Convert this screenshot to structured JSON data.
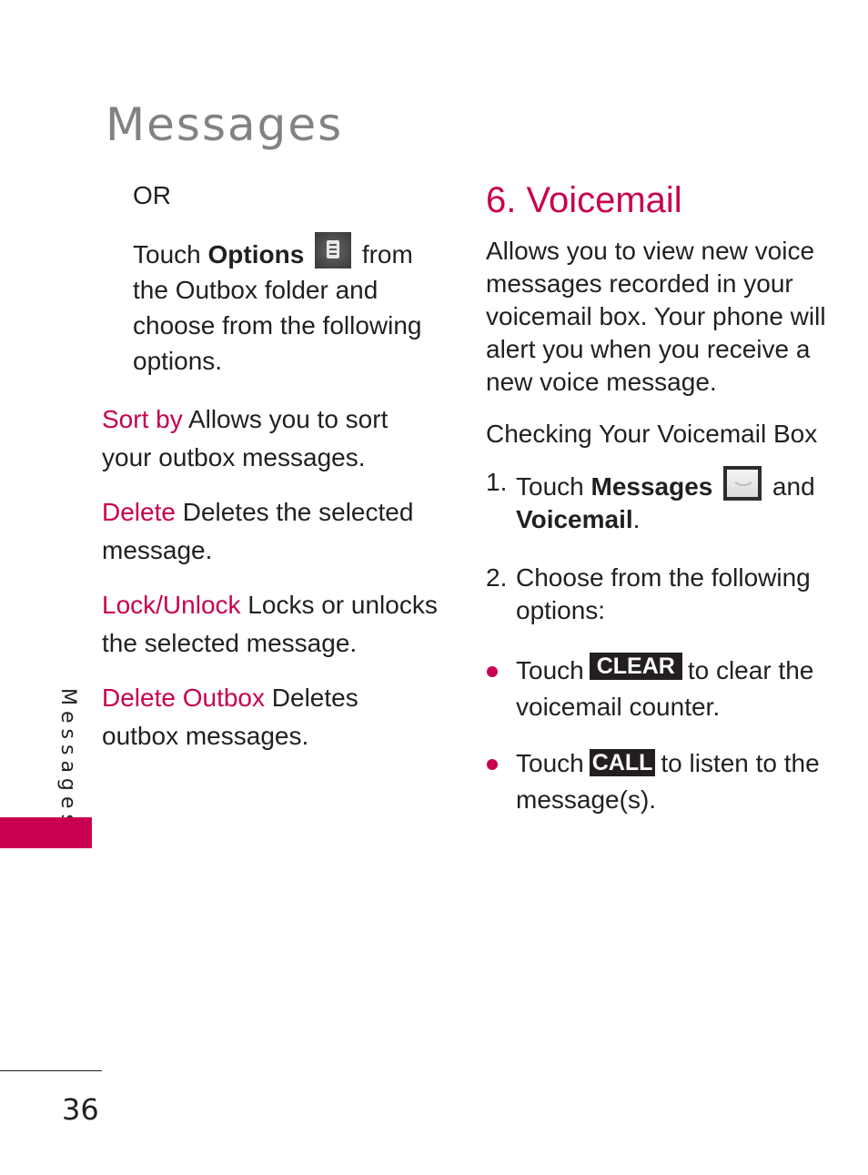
{
  "page": {
    "title": "Messages",
    "side_tab_label": "Messages",
    "page_number": "36",
    "accent_color": "#c8004f"
  },
  "left_column": {
    "or_text": "OR",
    "touch_options": {
      "prefix": "Touch ",
      "bold": "Options",
      "icon": "options-menu-icon",
      "suffix": " from the Outbox folder and choose from the following options."
    },
    "options": [
      {
        "term": "Sort by",
        "description": " Allows you to sort your outbox messages."
      },
      {
        "term": "Delete",
        "description": " Deletes the selected message."
      },
      {
        "term": "Lock/Unlock",
        "description": " Locks or unlocks the selected message."
      },
      {
        "term": "Delete Outbox",
        "description": " Deletes outbox messages."
      }
    ]
  },
  "right_column": {
    "section_title": "6. Voicemail",
    "intro": "Allows you to view new voice messages recorded in your voicemail box. Your phone will alert you when you receive a new voice message.",
    "subheading": "Checking Your Voicemail Box",
    "steps": [
      {
        "number": "1.",
        "prefix": "Touch ",
        "bold1": "Messages",
        "icon": "messages-envelope-icon",
        "middle": " and ",
        "bold2": "Voicemail",
        "suffix": "."
      },
      {
        "number": "2.",
        "text": "Choose from the following options:"
      }
    ],
    "bullets": [
      {
        "prefix": "Touch",
        "key": "CLEAR",
        "suffix": "to clear the voicemail counter."
      },
      {
        "prefix": "Touch",
        "key": "CALL",
        "suffix": "to listen to the message(s)."
      }
    ]
  }
}
